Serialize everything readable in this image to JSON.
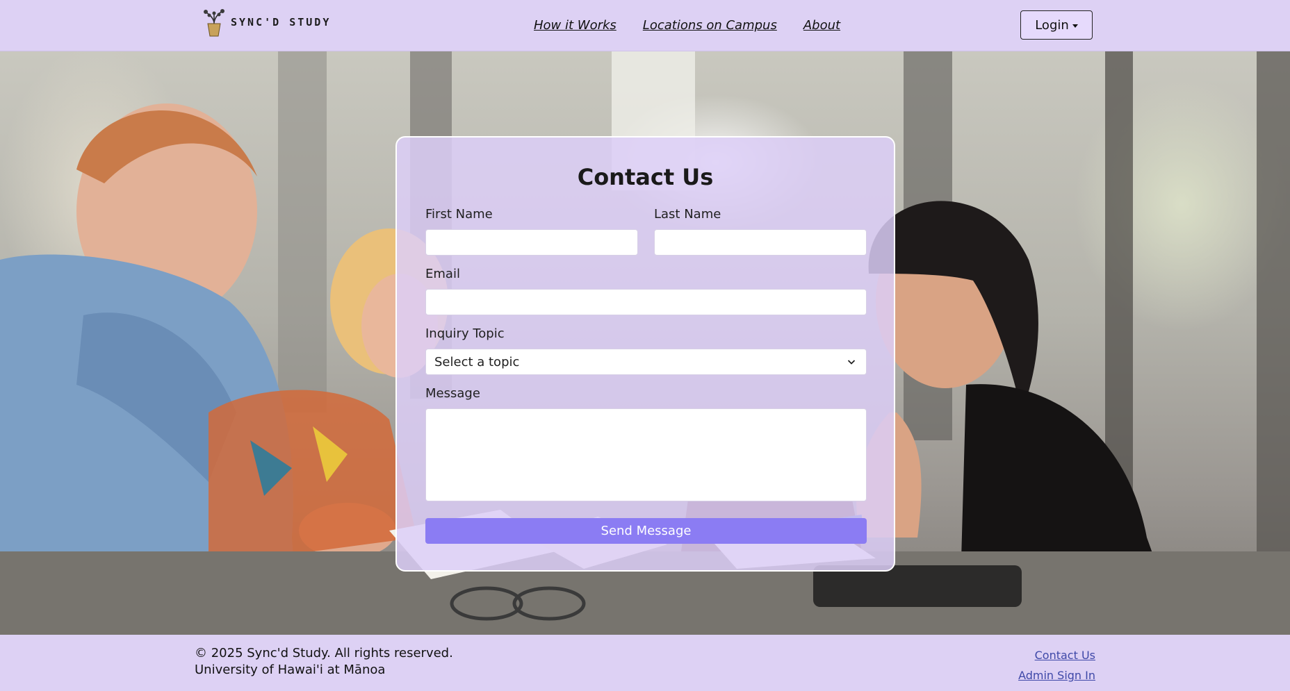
{
  "brand": {
    "name": "SYNC'D STUDY",
    "logo_icon": "plant-pot-icon"
  },
  "nav": {
    "links": [
      "How it Works",
      "Locations on Campus",
      "About"
    ],
    "login_label": "Login"
  },
  "contact_form": {
    "title": "Contact Us",
    "first_name_label": "First Name",
    "first_name_value": "",
    "last_name_label": "Last Name",
    "last_name_value": "",
    "email_label": "Email",
    "email_value": "",
    "topic_label": "Inquiry Topic",
    "topic_selected": "Select a topic",
    "message_label": "Message",
    "message_value": "",
    "submit_label": "Send Message"
  },
  "footer": {
    "copyright_line1": "© 2025 Sync'd Study. All rights reserved.",
    "copyright_line2": "University of Hawai'i at Mānoa",
    "links": [
      "Contact Us",
      "Admin Sign In"
    ]
  },
  "colors": {
    "navbar_bg": "#ddd1f4",
    "card_bg": "#ddcef8",
    "button_accent": "#8b7cf3",
    "footer_link": "#3e48a8"
  }
}
